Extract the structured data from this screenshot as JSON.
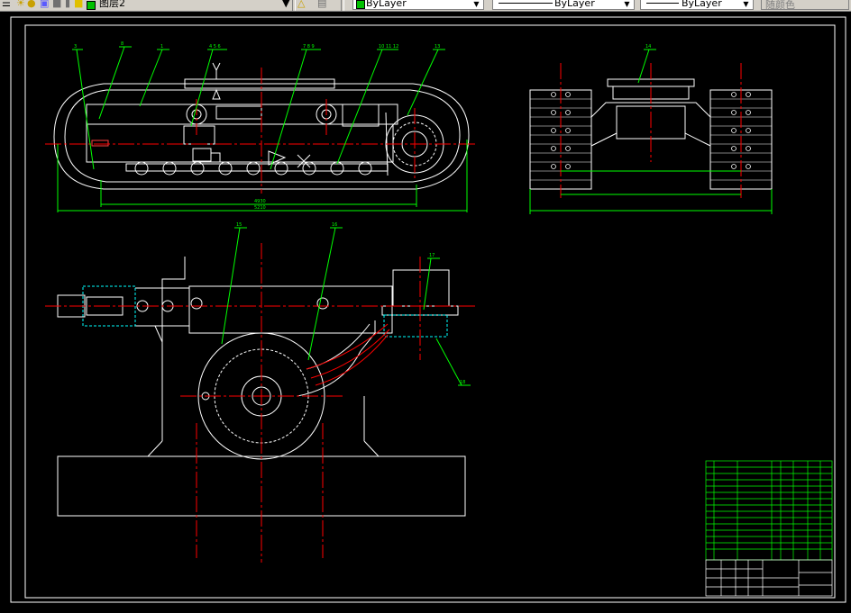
{
  "toolbar": {
    "layer_name": "图层2",
    "color_value": "ByLayer",
    "linetype_value": "ByLayer",
    "lineweight_value": "ByLayer",
    "plotstyle_value": "随颜色"
  },
  "drawing": {
    "callouts_top": [
      "3",
      "8",
      "1",
      "4 5 6",
      "7 8 9",
      "10 11 12",
      "13",
      "14"
    ],
    "callouts_bottom": [
      "15",
      "16",
      "17",
      "18"
    ],
    "dim_labels": [
      "4930",
      "5210"
    ],
    "colors": {
      "outline": "#ffffff",
      "leader": "#00ff00",
      "center": "#ff0000",
      "hidden": "#00ffff",
      "table": "#00ff00"
    }
  }
}
